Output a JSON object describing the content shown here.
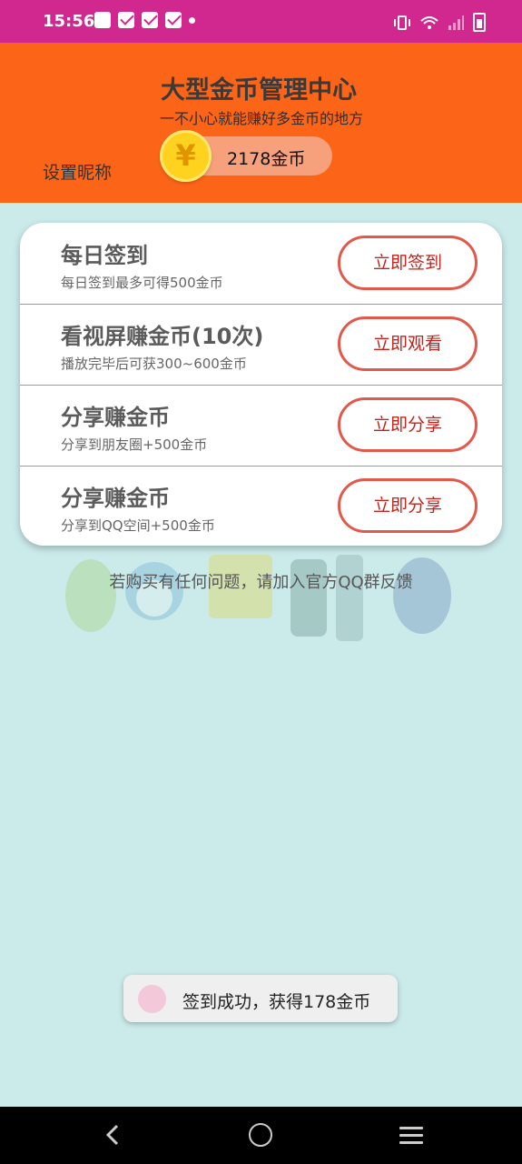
{
  "status_bar": {
    "time": "15:56",
    "icons": [
      "alert-icon",
      "mail-icon",
      "mail-icon",
      "mail-icon",
      "dot-icon",
      "vibrate-icon",
      "wifi-icon",
      "signal-icon",
      "battery-icon"
    ]
  },
  "header": {
    "title": "大型金币管理中心",
    "subtitle": "一不小心就能赚好多金币的地方",
    "nickname_label": "设置昵称",
    "coin_symbol": "¥",
    "coin_amount": "2178金币"
  },
  "tasks": [
    {
      "title": "每日签到",
      "desc": "每日签到最多可得500金币",
      "button": "立即签到"
    },
    {
      "title": "看视屏赚金币(10次)",
      "desc": "播放完毕后可获300~600金币",
      "button": "立即观看"
    },
    {
      "title": "分享赚金币",
      "desc": "分享到朋友圈+500金币",
      "button": "立即分享"
    },
    {
      "title": "分享赚金币",
      "desc": "分享到QQ空间+500金币",
      "button": "立即分享"
    }
  ],
  "notice": "若购买有任何问题，请加入官方QQ群反馈",
  "toast": {
    "text": "签到成功，获得178金币"
  },
  "colors": {
    "status_bar": "#d0288e",
    "header": "#fc6417",
    "background": "#cbeaea",
    "button_border": "#e0594b"
  }
}
